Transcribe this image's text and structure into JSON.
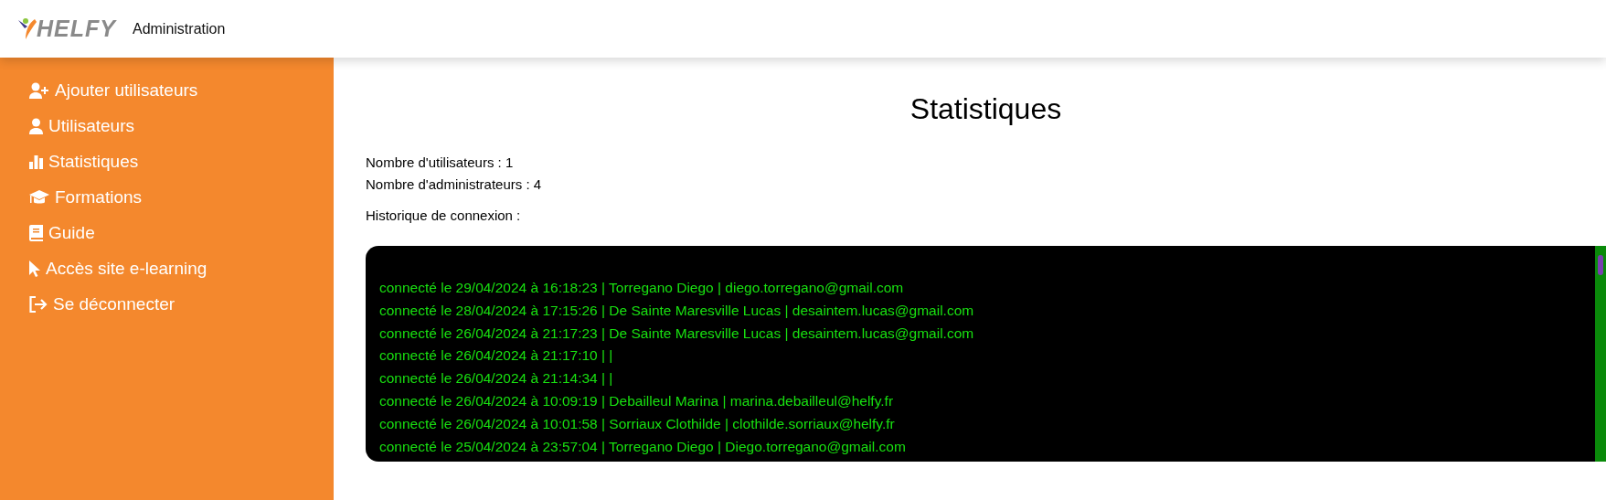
{
  "header": {
    "logo": "HELFY",
    "title": "Administration"
  },
  "sidebar": {
    "items": [
      {
        "kind": "user-add",
        "label": "Ajouter utilisateurs"
      },
      {
        "kind": "user",
        "label": "Utilisateurs"
      },
      {
        "kind": "chart",
        "label": "Statistiques"
      },
      {
        "kind": "cap",
        "label": "Formations"
      },
      {
        "kind": "book",
        "label": "Guide"
      },
      {
        "kind": "pointer",
        "label": "Accès site e-learning"
      },
      {
        "kind": "logout",
        "label": "Se déconnecter"
      }
    ]
  },
  "main": {
    "title": "Statistiques",
    "stats": [
      "Nombre d'utilisateurs : 1",
      "Nombre d'administrateurs : 4"
    ],
    "history_label": "Historique de connexion :",
    "log": [
      "connecté le 29/04/2024 à 16:18:23 | Torregano Diego | diego.torregano@gmail.com",
      "connecté le 28/04/2024 à 17:15:26 | De Sainte Maresville Lucas | desaintem.lucas@gmail.com",
      "connecté le 26/04/2024 à 21:17:23 | De Sainte Maresville Lucas | desaintem.lucas@gmail.com",
      "connecté le 26/04/2024 à 21:17:10 | |",
      "connecté le 26/04/2024 à 21:14:34 | |",
      "connecté le 26/04/2024 à 10:09:19 | Debailleul Marina | marina.debailleul@helfy.fr",
      "connecté le 26/04/2024 à 10:01:58 | Sorriaux Clothilde | clothilde.sorriaux@helfy.fr",
      "connecté le 25/04/2024 à 23:57:04 | Torregano Diego | Diego.torregano@gmail.com"
    ]
  }
}
